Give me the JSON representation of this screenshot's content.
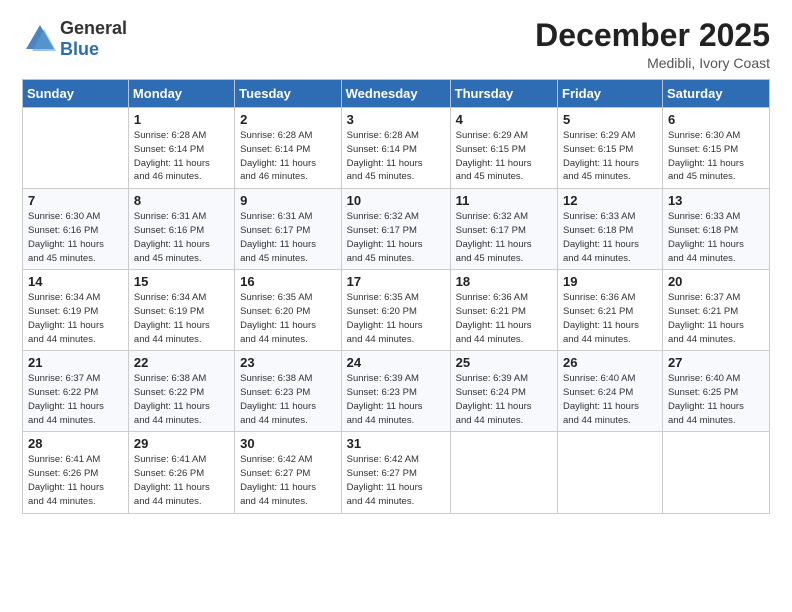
{
  "logo": {
    "general": "General",
    "blue": "Blue"
  },
  "header": {
    "month": "December 2025",
    "location": "Medibli, Ivory Coast"
  },
  "weekdays": [
    "Sunday",
    "Monday",
    "Tuesday",
    "Wednesday",
    "Thursday",
    "Friday",
    "Saturday"
  ],
  "weeks": [
    [
      {
        "day": "",
        "info": ""
      },
      {
        "day": "1",
        "info": "Sunrise: 6:28 AM\nSunset: 6:14 PM\nDaylight: 11 hours\nand 46 minutes."
      },
      {
        "day": "2",
        "info": "Sunrise: 6:28 AM\nSunset: 6:14 PM\nDaylight: 11 hours\nand 46 minutes."
      },
      {
        "day": "3",
        "info": "Sunrise: 6:28 AM\nSunset: 6:14 PM\nDaylight: 11 hours\nand 45 minutes."
      },
      {
        "day": "4",
        "info": "Sunrise: 6:29 AM\nSunset: 6:15 PM\nDaylight: 11 hours\nand 45 minutes."
      },
      {
        "day": "5",
        "info": "Sunrise: 6:29 AM\nSunset: 6:15 PM\nDaylight: 11 hours\nand 45 minutes."
      },
      {
        "day": "6",
        "info": "Sunrise: 6:30 AM\nSunset: 6:15 PM\nDaylight: 11 hours\nand 45 minutes."
      }
    ],
    [
      {
        "day": "7",
        "info": "Sunrise: 6:30 AM\nSunset: 6:16 PM\nDaylight: 11 hours\nand 45 minutes."
      },
      {
        "day": "8",
        "info": "Sunrise: 6:31 AM\nSunset: 6:16 PM\nDaylight: 11 hours\nand 45 minutes."
      },
      {
        "day": "9",
        "info": "Sunrise: 6:31 AM\nSunset: 6:17 PM\nDaylight: 11 hours\nand 45 minutes."
      },
      {
        "day": "10",
        "info": "Sunrise: 6:32 AM\nSunset: 6:17 PM\nDaylight: 11 hours\nand 45 minutes."
      },
      {
        "day": "11",
        "info": "Sunrise: 6:32 AM\nSunset: 6:17 PM\nDaylight: 11 hours\nand 45 minutes."
      },
      {
        "day": "12",
        "info": "Sunrise: 6:33 AM\nSunset: 6:18 PM\nDaylight: 11 hours\nand 44 minutes."
      },
      {
        "day": "13",
        "info": "Sunrise: 6:33 AM\nSunset: 6:18 PM\nDaylight: 11 hours\nand 44 minutes."
      }
    ],
    [
      {
        "day": "14",
        "info": "Sunrise: 6:34 AM\nSunset: 6:19 PM\nDaylight: 11 hours\nand 44 minutes."
      },
      {
        "day": "15",
        "info": "Sunrise: 6:34 AM\nSunset: 6:19 PM\nDaylight: 11 hours\nand 44 minutes."
      },
      {
        "day": "16",
        "info": "Sunrise: 6:35 AM\nSunset: 6:20 PM\nDaylight: 11 hours\nand 44 minutes."
      },
      {
        "day": "17",
        "info": "Sunrise: 6:35 AM\nSunset: 6:20 PM\nDaylight: 11 hours\nand 44 minutes."
      },
      {
        "day": "18",
        "info": "Sunrise: 6:36 AM\nSunset: 6:21 PM\nDaylight: 11 hours\nand 44 minutes."
      },
      {
        "day": "19",
        "info": "Sunrise: 6:36 AM\nSunset: 6:21 PM\nDaylight: 11 hours\nand 44 minutes."
      },
      {
        "day": "20",
        "info": "Sunrise: 6:37 AM\nSunset: 6:21 PM\nDaylight: 11 hours\nand 44 minutes."
      }
    ],
    [
      {
        "day": "21",
        "info": "Sunrise: 6:37 AM\nSunset: 6:22 PM\nDaylight: 11 hours\nand 44 minutes."
      },
      {
        "day": "22",
        "info": "Sunrise: 6:38 AM\nSunset: 6:22 PM\nDaylight: 11 hours\nand 44 minutes."
      },
      {
        "day": "23",
        "info": "Sunrise: 6:38 AM\nSunset: 6:23 PM\nDaylight: 11 hours\nand 44 minutes."
      },
      {
        "day": "24",
        "info": "Sunrise: 6:39 AM\nSunset: 6:23 PM\nDaylight: 11 hours\nand 44 minutes."
      },
      {
        "day": "25",
        "info": "Sunrise: 6:39 AM\nSunset: 6:24 PM\nDaylight: 11 hours\nand 44 minutes."
      },
      {
        "day": "26",
        "info": "Sunrise: 6:40 AM\nSunset: 6:24 PM\nDaylight: 11 hours\nand 44 minutes."
      },
      {
        "day": "27",
        "info": "Sunrise: 6:40 AM\nSunset: 6:25 PM\nDaylight: 11 hours\nand 44 minutes."
      }
    ],
    [
      {
        "day": "28",
        "info": "Sunrise: 6:41 AM\nSunset: 6:26 PM\nDaylight: 11 hours\nand 44 minutes."
      },
      {
        "day": "29",
        "info": "Sunrise: 6:41 AM\nSunset: 6:26 PM\nDaylight: 11 hours\nand 44 minutes."
      },
      {
        "day": "30",
        "info": "Sunrise: 6:42 AM\nSunset: 6:27 PM\nDaylight: 11 hours\nand 44 minutes."
      },
      {
        "day": "31",
        "info": "Sunrise: 6:42 AM\nSunset: 6:27 PM\nDaylight: 11 hours\nand 44 minutes."
      },
      {
        "day": "",
        "info": ""
      },
      {
        "day": "",
        "info": ""
      },
      {
        "day": "",
        "info": ""
      }
    ]
  ]
}
